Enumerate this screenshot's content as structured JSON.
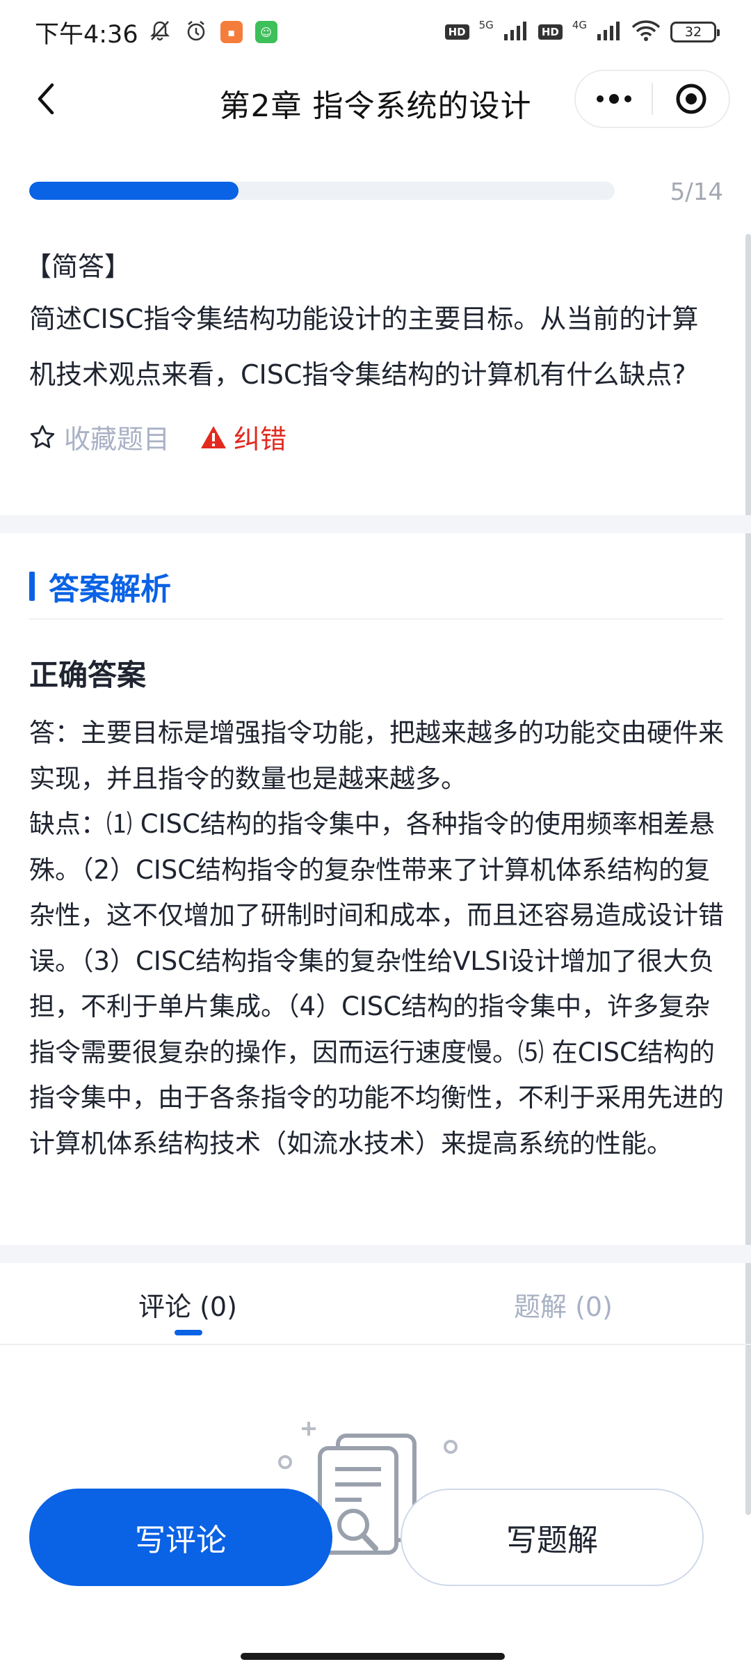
{
  "status_bar": {
    "time": "下午4:36",
    "network_5g": "5G",
    "network_4g": "4G",
    "hd": "HD",
    "battery": "32"
  },
  "nav": {
    "title": "第2章  指令系统的设计"
  },
  "progress": {
    "current": 5,
    "total": 14,
    "fraction": 0.357,
    "label": "5/14"
  },
  "question": {
    "type": "【简答】",
    "text": "简述CISC指令集结构功能设计的主要目标。从当前的计算机技术观点来看，CISC指令集结构的计算机有什么缺点?",
    "favorite_label": "收藏题目",
    "report_label": "纠错"
  },
  "answer": {
    "section_title": "答案解析",
    "label": "正确答案",
    "body": "答：主要目标是增强指令功能，把越来越多的功能交由硬件来实现，并且指令的数量也是越来越多。\n缺点：⑴ CISC结构的指令集中，各种指令的使用频率相差悬殊。（2）CISC结构指令的复杂性带来了计算机体系结构的复杂性，这不仅增加了研制时间和成本，而且还容易造成设计错误。（3）CISC结构指令集的复杂性给VLSI设计增加了很大负担，不利于单片集成。（4）CISC结构的指令集中，许多复杂指令需要很复杂的操作，因而运行速度慢。⑸ 在CISC结构的指令集中，由于各条指令的功能不均衡性，不利于采用先进的计算机体系结构技术（如流水技术）来提高系统的性能。"
  },
  "tabs": {
    "comments": "评论 (0)",
    "solutions": "题解 (0)"
  },
  "actions": {
    "write_comment": "写评论",
    "write_solution": "写题解"
  },
  "colors": {
    "accent": "#0a62e5",
    "error": "#e22a1f",
    "muted": "#a8b1c4"
  }
}
